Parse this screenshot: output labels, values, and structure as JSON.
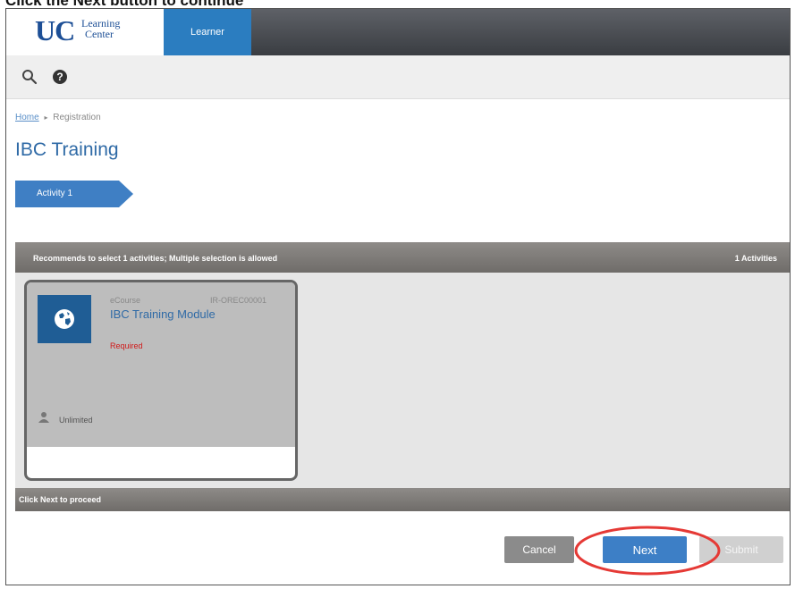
{
  "caption": "Click the Next button to continue",
  "brand": {
    "logo_main": "UC",
    "logo_line1": "Learning",
    "logo_line2": "Center"
  },
  "nav": {
    "active_tab": "Learner"
  },
  "toolbar": {
    "icons": [
      "search-icon",
      "help-icon"
    ]
  },
  "breadcrumb": {
    "home": "Home",
    "separator": "▸",
    "current": "Registration"
  },
  "page": {
    "title": "IBC Training"
  },
  "steps": [
    {
      "label": "Activity 1"
    }
  ],
  "activities": {
    "header_text": "Recommends to select 1 activities; Multiple selection is allowed",
    "count_text": "1 Activities",
    "items": [
      {
        "type": "eCourse",
        "code": "IR-OREC00001",
        "title": "IBC Training Module",
        "status": "Required",
        "seats": "Unlimited"
      }
    ]
  },
  "footer": {
    "hint": "Click Next to proceed"
  },
  "buttons": {
    "cancel": "Cancel",
    "next": "Next",
    "submit": "Submit"
  },
  "colors": {
    "brand_blue": "#1d4f96",
    "active_tab": "#2b7dc0",
    "next_button": "#3d7fc6",
    "highlight": "#e53935",
    "required_text": "#d01818"
  }
}
